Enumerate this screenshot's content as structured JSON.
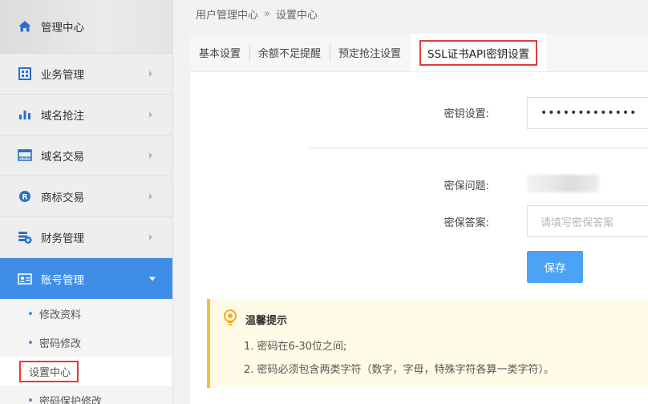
{
  "sidebar": {
    "home": {
      "label": "管理中心",
      "icon": "home-icon"
    },
    "items": [
      {
        "label": "业务管理",
        "icon": "grid-icon"
      },
      {
        "label": "域名抢注",
        "icon": "bar-chart-icon"
      },
      {
        "label": "域名交易",
        "icon": "www-icon"
      },
      {
        "label": "商标交易",
        "icon": "registered-icon"
      },
      {
        "label": "财务管理",
        "icon": "coins-icon"
      },
      {
        "label": "账号管理",
        "icon": "id-card-icon",
        "active": true
      }
    ],
    "submenu": [
      {
        "label": "修改资料"
      },
      {
        "label": "密码修改"
      },
      {
        "label": "设置中心",
        "current": true
      },
      {
        "label": "密码保护修改"
      }
    ]
  },
  "breadcrumb": {
    "root": "用户管理中心",
    "separator": "»",
    "current": "设置中心"
  },
  "tabs": [
    {
      "label": "基本设置"
    },
    {
      "label": "余额不足提醒"
    },
    {
      "label": "预定抢注设置"
    },
    {
      "label": "SSL证书API密钥设置",
      "active": true
    }
  ],
  "form": {
    "key_label": "密钥设置:",
    "key_value": "•••••••••••••",
    "question_label": "密保问题:",
    "answer_label": "密保答案:",
    "answer_placeholder": "请填写密保答案",
    "save_label": "保存"
  },
  "tip": {
    "title": "温馨提示",
    "lines": [
      "1. 密码在6-30位之间;",
      "2. 密码必须包含两类字符（数字，字母，特殊字符各算一类字符）。"
    ]
  },
  "colors": {
    "accent": "#3e8ee8",
    "button": "#4aa3f5",
    "highlight_border": "#e23b3b",
    "tip_bg": "#fffbe6",
    "tip_bar": "#f5c13c"
  }
}
